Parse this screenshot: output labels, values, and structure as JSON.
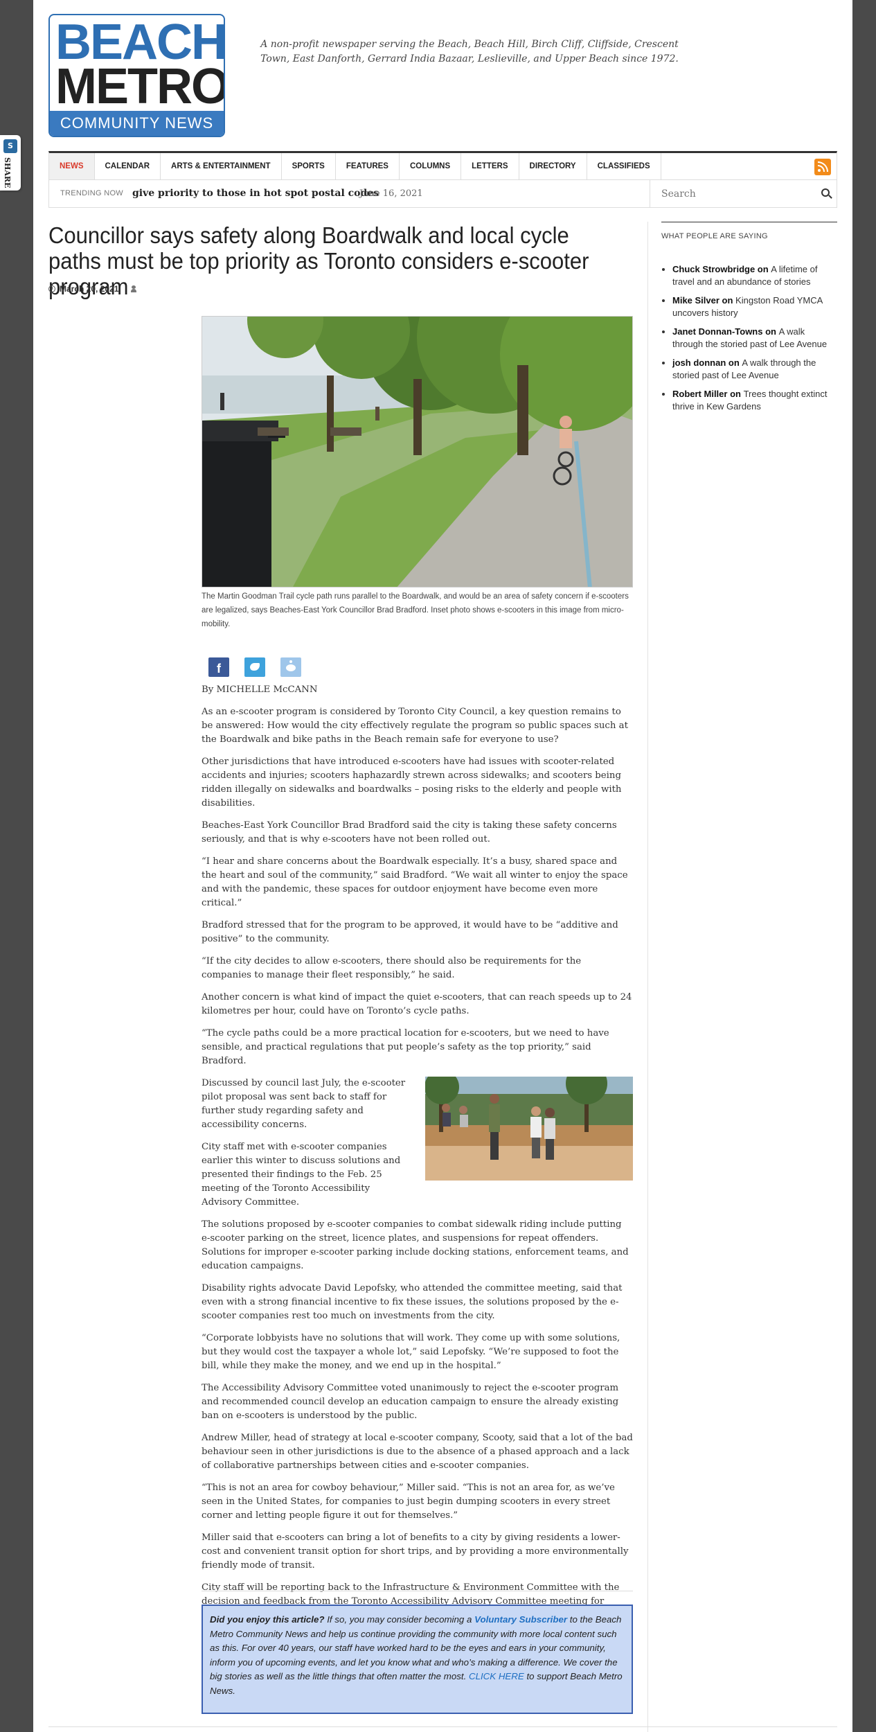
{
  "share": {
    "label": "SHARE"
  },
  "logo": {
    "line1": "BEACH",
    "line2": "METRO",
    "line3": "COMMUNITY NEWS"
  },
  "tagline": "A non-profit newspaper serving the Beach, Beach Hill, Birch Cliff, Cliffside, Crescent Town, East Danforth, Gerrard India Bazaar, Leslieville, and Upper Beach since 1972.",
  "nav": {
    "items": [
      {
        "label": "NEWS",
        "active": true
      },
      {
        "label": "CALENDAR"
      },
      {
        "label": "ARTS & ENTERTAINMENT"
      },
      {
        "label": "SPORTS"
      },
      {
        "label": "FEATURES"
      },
      {
        "label": "COLUMNS"
      },
      {
        "label": "LETTERS"
      },
      {
        "label": "DIRECTORY"
      },
      {
        "label": "CLASSIFIEDS"
      }
    ],
    "rss_icon": "rss-icon"
  },
  "trending": {
    "label": "TRENDING NOW",
    "text": "give priority to those in hot spot postal codes",
    "date": "June 16, 2021"
  },
  "search": {
    "placeholder": "Search"
  },
  "article": {
    "title": "Councillor says safety along Boardwalk and local cycle paths must be top priority as Toronto considers e-scooter program",
    "date": "March 20, 2021",
    "caption": "The Martin Goodman Trail cycle path runs parallel to the Boardwalk, and would be an area of safety concern if e-scooters are legalized, says Beaches-East York Councillor Brad Bradford. Inset photo shows e-scooters in this image from micro-mobility.",
    "byline": "By MICHELLE McCANN",
    "paragraphs": [
      "As an e-scooter program is considered by Toronto City Council, a key question remains to be answered: How would the city effectively regulate the program so public spaces such at the Boardwalk and bike paths in the Beach remain safe for everyone to use?",
      "Other jurisdictions that have introduced e-scooters have had issues with scooter-related accidents and injuries; scooters haphazardly strewn across sidewalks; and scooters being ridden illegally on sidewalks and boardwalks – posing risks to the elderly and people with disabilities.",
      "Beaches-East York Councillor Brad Bradford said the city is taking these safety concerns seriously, and that is why e-scooters have not been rolled out.",
      "“I hear and share concerns about the Boardwalk especially. It’s a busy, shared space and the heart and soul of the community,” said Bradford. “We wait all winter to enjoy the space and with the pandemic, these spaces for outdoor enjoyment have become even more critical.”",
      "Bradford stressed that for the program to be approved, it would have to be “additive and positive” to the community.",
      "“If the city decides to allow e-scooters, there should also be requirements for the companies to manage their fleet responsibly,” he said.",
      "Another concern is what kind of impact the quiet e-scooters, that can reach speeds up to 24 kilometres per hour, could have on Toronto’s cycle paths.",
      "“The cycle paths could be a more practical location for e-scooters, but we need to have sensible, and practical regulations that put people’s safety as the top priority,” said Bradford.",
      "Discussed by council last July, the e-scooter pilot proposal was sent back to staff for further study regarding safety and accessibility concerns.",
      "City staff met with e-scooter companies earlier this winter to discuss solutions and presented their findings to the Feb. 25 meeting of the Toronto Accessibility Advisory Committee.",
      "The solutions proposed by e-scooter companies to combat sidewalk riding include putting e-scooter parking on the street, licence plates, and suspensions for repeat offenders. Solutions for improper e-scooter parking include docking stations, enforcement teams, and education campaigns.",
      "Disability rights advocate David Lepofsky, who attended the committee meeting, said that even with a strong financial incentive to fix these issues, the solutions proposed by the e-scooter companies rest too much on investments from the city.",
      "“Corporate lobbyists have no solutions that will work. They come up with some solutions, but they would cost the taxpayer a whole lot,” said Lepofsky. “We’re supposed to foot the bill, while they make the money, and we end up in the hospital.”",
      "The Accessibility Advisory Committee voted unanimously to reject the e-scooter program and recommended council develop an education campaign to ensure the already existing ban on e-scooters is understood by the public.",
      "Andrew Miller, head of strategy at local e-scooter company, Scooty, said that a lot of the bad behaviour seen in other jurisdictions is due to the absence of a phased approach and a lack of collaborative partnerships between cities and e-scooter companies.",
      "“This is not an area for cowboy behaviour,” Miller said. “This is not an area for, as we’ve seen in the United States, for companies to just begin dumping scooters in every street corner and letting people figure it out for themselves.”",
      "Miller said that e-scooters can bring a lot of benefits to a city by giving residents a lower-cost and convenient transit option for short trips, and by providing a more environmentally friendly mode of transit.",
      "City staff will be reporting back to the Infrastructure & Environment Committee with the decision and feedback from the Toronto Accessibility Advisory Committee meeting for review in the upcoming months."
    ],
    "trailing_dot": "."
  },
  "support": {
    "lead": "Did you enjoy this article?",
    "text1": " If so, you may consider becoming a ",
    "link1": "Voluntary Subscriber",
    "text2": " to the Beach Metro Community News and help us continue providing the community with more local content such as this. For over 40 years, our staff have worked hard to be the eyes and ears in your community, inform you of upcoming events, and let you know what and who’s making a difference. We cover the big stories as well as the little things that often matter the most. ",
    "link2": "CLICK HERE",
    "text3": " to support Beach Metro News."
  },
  "sidebar": {
    "heading": "WHAT PEOPLE ARE SAYING",
    "comments": [
      {
        "author": "Chuck Strowbridge",
        "on": " on ",
        "post": "A lifetime of travel and an abundance of stories"
      },
      {
        "author": "Mike Silver",
        "on": " on ",
        "post": "Kingston Road YMCA uncovers history"
      },
      {
        "author": "Janet Donnan-Towns",
        "on": " on ",
        "post": "A walk through the storied past of Lee Avenue"
      },
      {
        "author": "josh donnan",
        "on": " on ",
        "post": "A walk through the storied past of Lee Avenue"
      },
      {
        "author": "Robert Miller",
        "on": " on ",
        "post": "Trees thought extinct thrive in Kew Gardens"
      }
    ]
  },
  "colors": {
    "brand_blue": "#2e6fb3",
    "nav_active": "#d93a2b",
    "rss": "#f28b1a",
    "support_bg": "#c9d9f5"
  }
}
